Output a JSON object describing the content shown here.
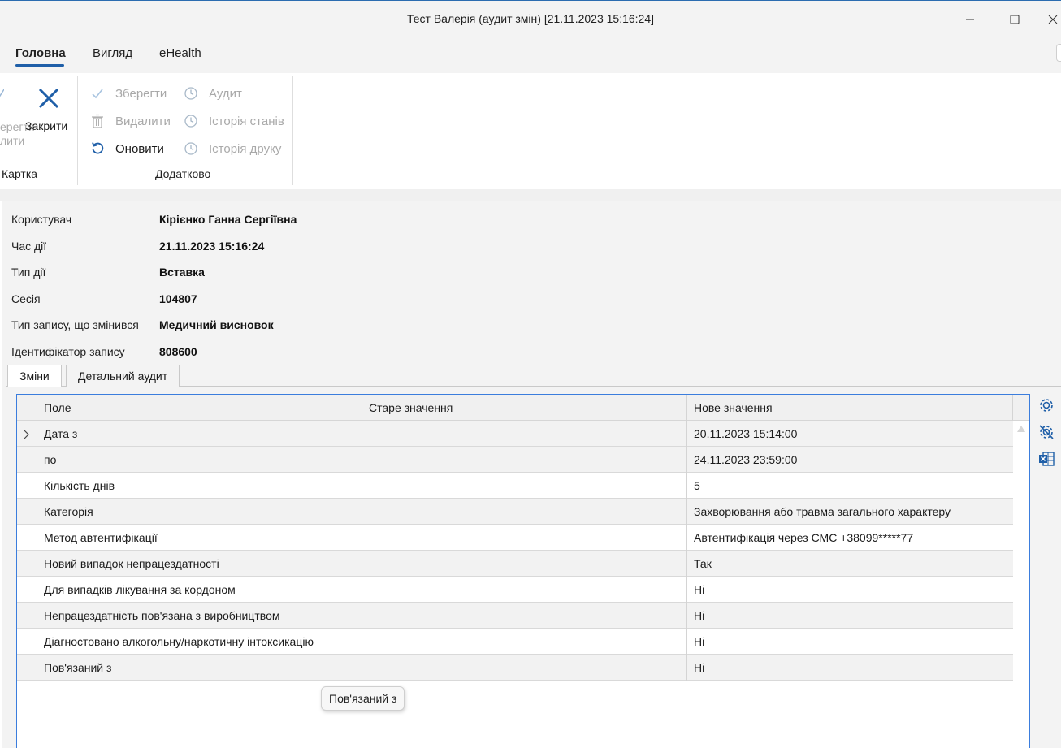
{
  "window": {
    "title": "Тест Валерія (аудит змін) [21.11.2023 15:16:24]",
    "controls": [
      "minimize-icon",
      "maximize-icon",
      "close-icon"
    ]
  },
  "ribbon_tabs": [
    {
      "label": "Головна",
      "active": true
    },
    {
      "label": "Вигляд",
      "active": false
    },
    {
      "label": "eHealth",
      "active": false
    }
  ],
  "ribbon": {
    "card_group": {
      "partial_save_label": "ерегти",
      "partial_delete_label": "лити",
      "close_label": "Закрити",
      "group_label": "Картка"
    },
    "extra_group": {
      "save_label": "Зберегти",
      "delete_label": "Видалити",
      "refresh_label": "Оновити",
      "audit_label": "Аудит",
      "state_history_label": "Історія станів",
      "print_history_label": "Історія друку",
      "group_label": "Додатково"
    }
  },
  "record": {
    "fields": [
      {
        "label": "Користувач",
        "value": "Кірієнко Ганна Сергіївна"
      },
      {
        "label": "Час дії",
        "value": "21.11.2023 15:16:24"
      },
      {
        "label": "Тип дії",
        "value": "Вставка"
      },
      {
        "label": "Сесія",
        "value": "104807"
      },
      {
        "label": "Тип запису, що змінився",
        "value": "Медичний висновок"
      },
      {
        "label": "Ідентифікатор запису",
        "value": "808600"
      }
    ]
  },
  "inner_tabs": [
    {
      "label": "Зміни",
      "active": true
    },
    {
      "label": "Детальний аудит",
      "active": false
    }
  ],
  "grid": {
    "columns": [
      "Поле",
      "Старе значення",
      "Нове значення"
    ],
    "rows": [
      {
        "field": "Дата з",
        "old": "",
        "new": "20.11.2023 15:14:00"
      },
      {
        "field": "по",
        "old": "",
        "new": "24.11.2023 23:59:00"
      },
      {
        "field": "Кількість днів",
        "old": "",
        "new": "5"
      },
      {
        "field": "Категорія",
        "old": "",
        "new": "Захворювання або травма загального характеру"
      },
      {
        "field": "Метод автентифікації",
        "old": "",
        "new": "Автентифікація через СМС +38099*****77"
      },
      {
        "field": "Новий випадок непрацездатності",
        "old": "",
        "new": "Так"
      },
      {
        "field": "Для випадків лікування за кордоном",
        "old": "",
        "new": "Ні"
      },
      {
        "field": "Непрацездатність пов'язана з виробництвом",
        "old": "",
        "new": "Ні"
      },
      {
        "field": "Діагностовано алкогольну/наркотичну інтоксикацію",
        "old": "",
        "new": "Ні"
      },
      {
        "field": "Пов'язаний з",
        "old": "",
        "new": "Ні"
      }
    ]
  },
  "tooltip": "Пов'язаний з",
  "side_tools": [
    "settings-icon",
    "settings-reset-icon",
    "excel-export-icon"
  ],
  "colors": {
    "accent": "#1f5fa8",
    "selection_border": "#3b7ddd"
  }
}
